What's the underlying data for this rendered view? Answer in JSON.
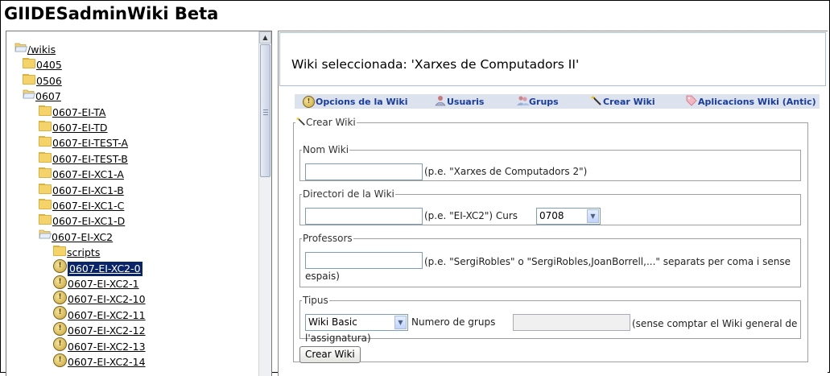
{
  "app": {
    "title": "GIIDESadminWiki Beta"
  },
  "tree": {
    "items": [
      {
        "label": "/wikis",
        "icon": "open-folder-icon",
        "depth": 0,
        "selected": false
      },
      {
        "label": "0405",
        "icon": "folder-icon",
        "depth": 1,
        "selected": false
      },
      {
        "label": "0506",
        "icon": "folder-icon",
        "depth": 1,
        "selected": false
      },
      {
        "label": "0607",
        "icon": "open-folder-icon",
        "depth": 1,
        "selected": false
      },
      {
        "label": "0607-EI-TA",
        "icon": "folder-icon",
        "depth": 2,
        "selected": false
      },
      {
        "label": "0607-EI-TD",
        "icon": "folder-icon",
        "depth": 2,
        "selected": false
      },
      {
        "label": "0607-EI-TEST-A",
        "icon": "folder-icon",
        "depth": 2,
        "selected": false
      },
      {
        "label": "0607-EI-TEST-B",
        "icon": "folder-icon",
        "depth": 2,
        "selected": false
      },
      {
        "label": "0607-EI-XC1-A",
        "icon": "folder-icon",
        "depth": 2,
        "selected": false
      },
      {
        "label": "0607-EI-XC1-B",
        "icon": "folder-icon",
        "depth": 2,
        "selected": false
      },
      {
        "label": "0607-EI-XC1-C",
        "icon": "folder-icon",
        "depth": 2,
        "selected": false
      },
      {
        "label": "0607-EI-XC1-D",
        "icon": "folder-icon",
        "depth": 2,
        "selected": false
      },
      {
        "label": "0607-EI-XC2",
        "icon": "open-folder-icon",
        "depth": 2,
        "selected": false
      },
      {
        "label": "scripts",
        "icon": "folder-icon",
        "depth": 3,
        "selected": false
      },
      {
        "label": "0607-EI-XC2-0",
        "icon": "wiki-icon",
        "depth": 3,
        "selected": true
      },
      {
        "label": "0607-EI-XC2-1",
        "icon": "wiki-icon",
        "depth": 3,
        "selected": false
      },
      {
        "label": "0607-EI-XC2-10",
        "icon": "wiki-icon",
        "depth": 3,
        "selected": false
      },
      {
        "label": "0607-EI-XC2-11",
        "icon": "wiki-icon",
        "depth": 3,
        "selected": false
      },
      {
        "label": "0607-EI-XC2-12",
        "icon": "wiki-icon",
        "depth": 3,
        "selected": false
      },
      {
        "label": "0607-EI-XC2-13",
        "icon": "wiki-icon",
        "depth": 3,
        "selected": false
      },
      {
        "label": "0607-EI-XC2-14",
        "icon": "wiki-icon",
        "depth": 3,
        "selected": false
      }
    ]
  },
  "header": {
    "title": "Wiki seleccionada: 'Xarxes de Computadors II'"
  },
  "tabs": [
    {
      "label": "Opcions de la Wiki",
      "icon": "wiki-icon"
    },
    {
      "label": "Usuaris",
      "icon": "users-icon"
    },
    {
      "label": "Grups",
      "icon": "groups-icon"
    },
    {
      "label": "Crear Wiki",
      "icon": "wand-icon"
    },
    {
      "label": "Aplicacions Wiki (Antic)",
      "icon": "tag-icon"
    }
  ],
  "form": {
    "legend": "Crear Wiki",
    "nom": {
      "legend": "Nom Wiki",
      "value": "",
      "hint": "(p.e. \"Xarxes de Computadors 2\")"
    },
    "directori": {
      "legend": "Directori de la Wiki",
      "value": "",
      "hint": "(p.e. \"EI-XC2\") Curs",
      "curs_value": "0708"
    },
    "professors": {
      "legend": "Professors",
      "value": "",
      "hint": "(p.e. \"SergiRobles\" o \"SergiRobles,JoanBorrell,...\" separats per coma i sense espais)"
    },
    "tipus": {
      "legend": "Tipus",
      "value": "Wiki Basic",
      "grups_label": "Numero de grups",
      "grups_value": "",
      "hint": "(sense comptar el Wiki general de l'assignatura)"
    },
    "submit_label": "Crear Wiki"
  }
}
